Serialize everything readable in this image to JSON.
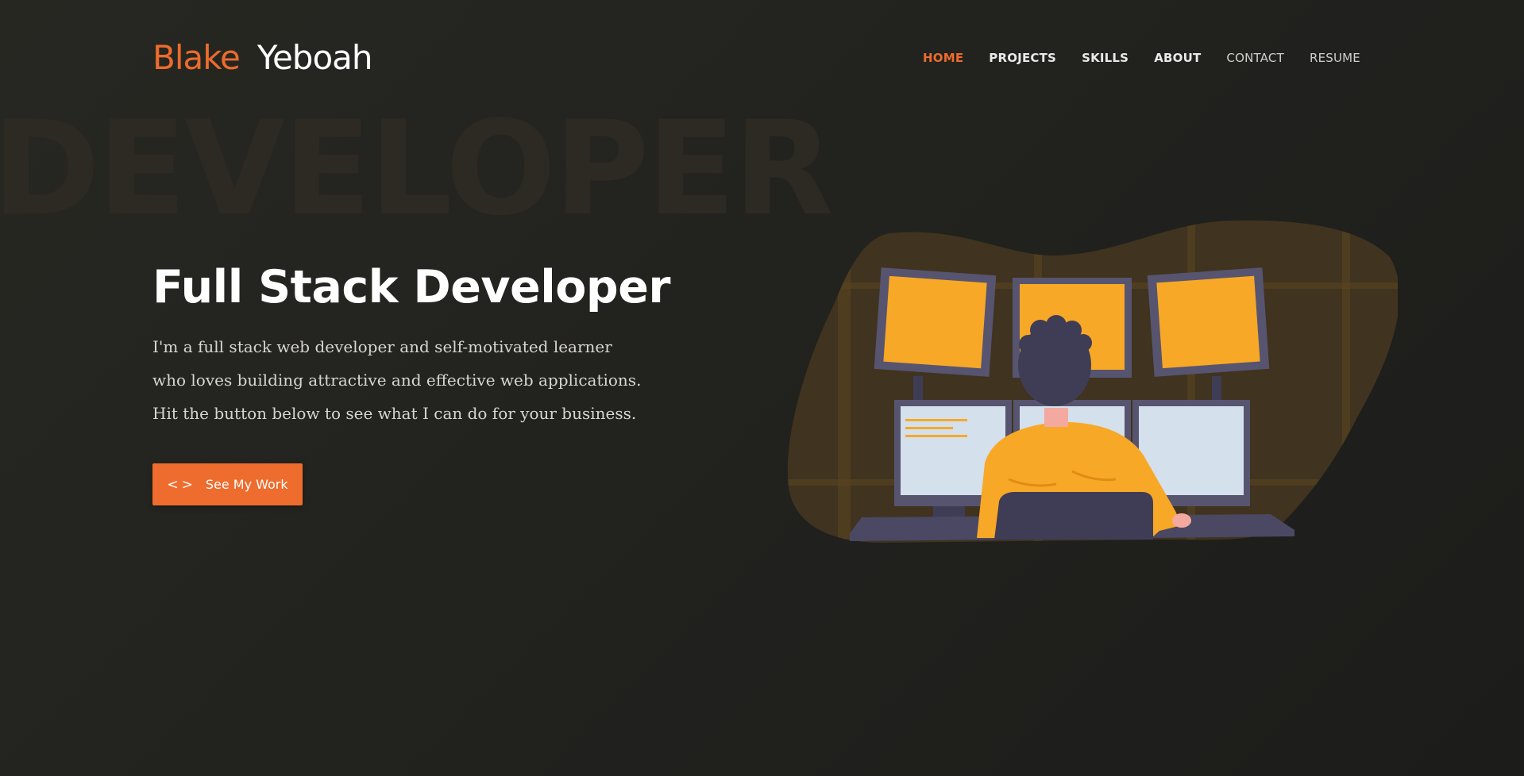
{
  "brand": {
    "first_name": "Blake",
    "last_name": "Yeboah"
  },
  "nav": {
    "items": [
      {
        "label": "HOME",
        "state": "active"
      },
      {
        "label": "PROJECTS",
        "state": "normal"
      },
      {
        "label": "SKILLS",
        "state": "normal"
      },
      {
        "label": "ABOUT",
        "state": "normal"
      },
      {
        "label": "CONTACT",
        "state": "light"
      },
      {
        "label": "RESUME",
        "state": "light"
      }
    ]
  },
  "hero": {
    "background_word": "DEVELOPER",
    "headline": "Full Stack Developer",
    "bio": "I'm a full stack web developer and self-motivated learner who loves building attractive and effective web applications. Hit the button below to see what I can do for your business.",
    "cta": {
      "label": "See My Work",
      "icon": "code-icon"
    }
  },
  "colors": {
    "accent": "#ec6b2d",
    "background": "#252521",
    "text": "#ffffff",
    "illustration_yellow": "#f8a827",
    "illustration_dark": "#3f3d56"
  }
}
